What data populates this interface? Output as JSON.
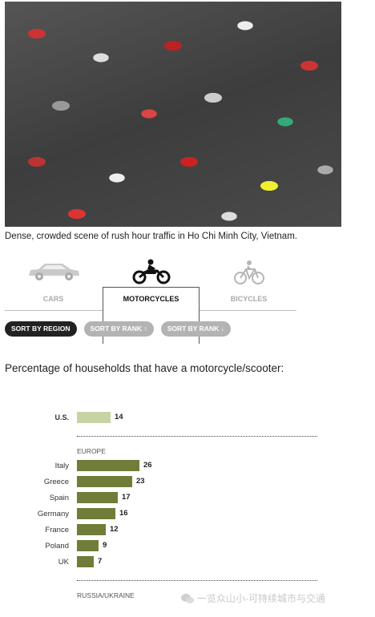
{
  "photo": {
    "caption": "Dense, crowded scene of rush hour traffic in Ho Chi Minh City, Vietnam."
  },
  "tabs": [
    {
      "label": "CARS",
      "icon": "car-icon",
      "active": false
    },
    {
      "label": "MOTORCYCLES",
      "icon": "motorcycle-icon",
      "active": true
    },
    {
      "label": "BICYCLES",
      "icon": "bicycle-icon",
      "active": false
    }
  ],
  "sort": {
    "by_region": "SORT BY REGION",
    "by_rank_up": "SORT BY RANK ↑",
    "by_rank_down": "SORT BY RANK ↓"
  },
  "chart_title": "Percentage of households that have a motorcycle/scooter:",
  "chart_data": {
    "type": "bar",
    "orientation": "horizontal",
    "colors": {
      "us": "#c7d3a2",
      "region": "#707d38"
    },
    "groups": [
      {
        "name": "",
        "items": [
          {
            "label": "U.S.",
            "value": 14
          }
        ]
      },
      {
        "name": "EUROPE",
        "items": [
          {
            "label": "Italy",
            "value": 26
          },
          {
            "label": "Greece",
            "value": 23
          },
          {
            "label": "Spain",
            "value": 17
          },
          {
            "label": "Germany",
            "value": 16
          },
          {
            "label": "France",
            "value": 12
          },
          {
            "label": "Poland",
            "value": 9
          },
          {
            "label": "UK",
            "value": 7
          }
        ]
      },
      {
        "name": "RUSSIA/UKRAINE",
        "items": []
      }
    ]
  },
  "watermark": "一览众山小-可持续城市与交通"
}
